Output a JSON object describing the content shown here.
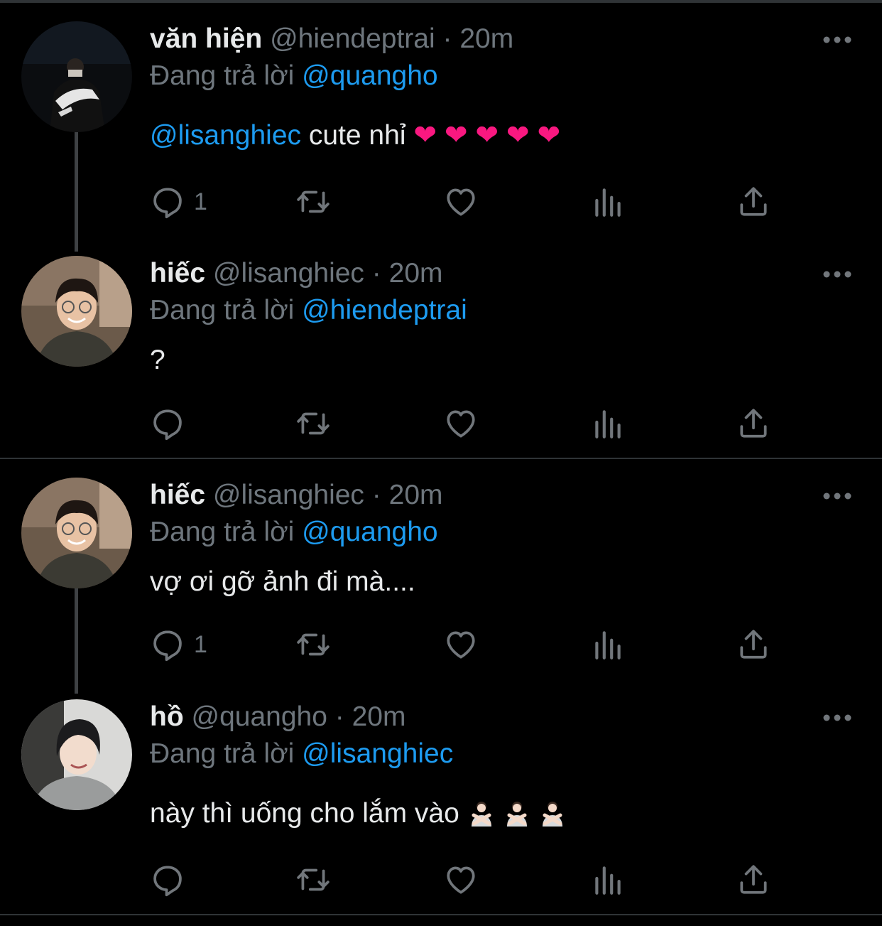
{
  "replying_prefix": "Đang trả lời",
  "tweets": [
    {
      "name": "văn hiện",
      "handle": "@hiendeptrai",
      "dot": "·",
      "time": "20m",
      "reply_to": "@quangho",
      "mention": "@lisanghiec",
      "text": " cute nhỉ ",
      "hearts": [
        "❤",
        "❤",
        "❤",
        "❤",
        "❤"
      ],
      "reply_count": "1",
      "avatar": "avatar-hiendeptrai"
    },
    {
      "name": "hiếc",
      "handle": "@lisanghiec",
      "dot": "·",
      "time": "20m",
      "reply_to": "@hiendeptrai",
      "text": "?",
      "reply_count": "",
      "avatar": "avatar-lisanghiec"
    },
    {
      "name": "hiếc",
      "handle": "@lisanghiec",
      "dot": "·",
      "time": "20m",
      "reply_to": "@quangho",
      "text": "vợ ơi gỡ ảnh đi mà....",
      "reply_count": "1",
      "avatar": "avatar-lisanghiec"
    },
    {
      "name": "hồ",
      "handle": "@quangho",
      "dot": "·",
      "time": "20m",
      "reply_to": "@lisanghiec",
      "text": "này thì uống cho lắm vào ",
      "emoji_count": 3,
      "emoji": "person-gesturing-no-icon",
      "reply_count": "",
      "avatar": "avatar-quangho"
    }
  ],
  "colors": {
    "background": "#000000",
    "text": "#e7e9ea",
    "secondary": "#6e767d",
    "link": "#1d9bf0",
    "icon": "#71767b",
    "separator": "#2f3336"
  },
  "icons": [
    "reply-icon",
    "retweet-icon",
    "like-icon",
    "analytics-icon",
    "share-icon",
    "more-icon"
  ]
}
